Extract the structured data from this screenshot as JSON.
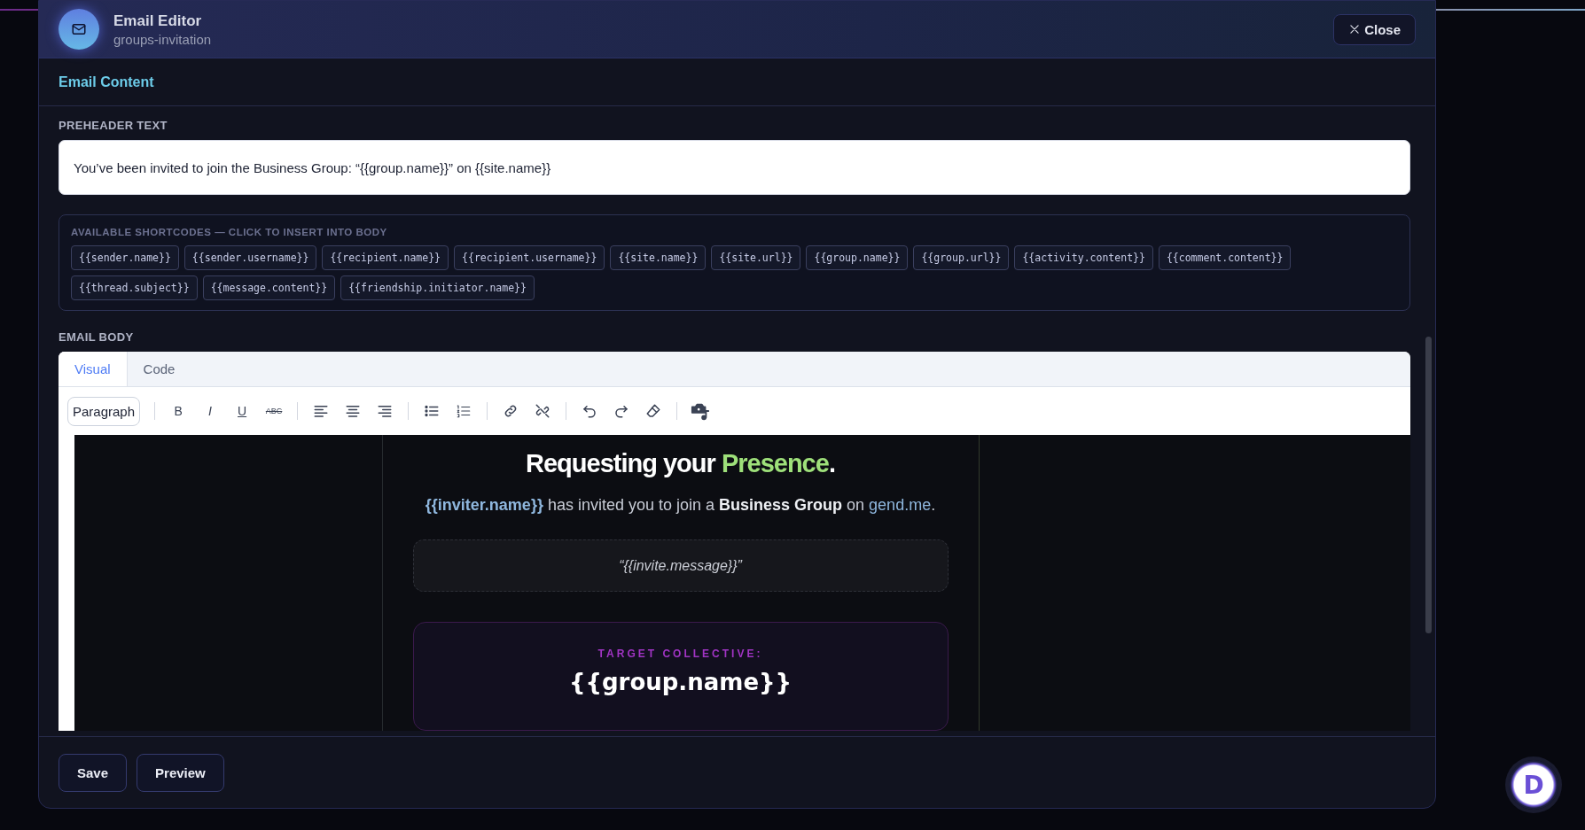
{
  "header": {
    "title": "Email Editor",
    "subtitle": "groups-invitation",
    "close_button": "Close"
  },
  "section_title": "Email Content",
  "preheader": {
    "label": "PREHEADER TEXT",
    "value": "You’ve been invited to join the Business Group: “{{group.name}}” on {{site.name}}"
  },
  "shortcodes": {
    "title": "AVAILABLE SHORTCODES — CLICK TO INSERT INTO BODY",
    "items": [
      "{{sender.name}}",
      "{{sender.username}}",
      "{{recipient.name}}",
      "{{recipient.username}}",
      "{{site.name}}",
      "{{site.url}}",
      "{{group.name}}",
      "{{group.url}}",
      "{{activity.content}}",
      "{{comment.content}}",
      "{{thread.subject}}",
      "{{message.content}}",
      "{{friendship.initiator.name}}"
    ]
  },
  "email_body": {
    "label": "EMAIL BODY",
    "tabs": [
      {
        "label": "Visual",
        "selected": true
      },
      {
        "label": "Code",
        "selected": false
      }
    ],
    "toolbar": {
      "block_format": "Paragraph",
      "groups": [
        [
          {
            "kind": "bold",
            "label": "B"
          },
          {
            "kind": "italic",
            "label": "I"
          },
          {
            "kind": "underline",
            "label": "U"
          },
          {
            "kind": "strike",
            "label": "ABC"
          }
        ],
        [
          {
            "kind": "align-left"
          },
          {
            "kind": "align-center"
          },
          {
            "kind": "align-right"
          }
        ],
        [
          {
            "kind": "bullet-list"
          },
          {
            "kind": "number-list"
          }
        ],
        [
          {
            "kind": "link"
          },
          {
            "kind": "unlink"
          }
        ],
        [
          {
            "kind": "undo"
          },
          {
            "kind": "redo"
          },
          {
            "kind": "eraser"
          }
        ],
        [
          {
            "kind": "media"
          }
        ]
      ]
    },
    "preview": {
      "heading_lead": "Requesting your ",
      "heading_accent": "Presence",
      "heading_tail": ".",
      "intro": [
        {
          "kind": "variable",
          "text": "{{inviter.name}}"
        },
        {
          "kind": "plain",
          "text": " has invited you to join a "
        },
        {
          "kind": "strong",
          "text": "Business Group"
        },
        {
          "kind": "plain",
          "text": " on "
        },
        {
          "kind": "link",
          "text": "gend.me"
        },
        {
          "kind": "plain",
          "text": "."
        }
      ],
      "quote": "“{{invite.message}}”",
      "target_label": "TARGET COLLECTIVE:",
      "target_name": "{{group.name}}"
    }
  },
  "footer_buttons": [
    "Save",
    "Preview"
  ],
  "assistant_badge": {
    "label": "D"
  }
}
